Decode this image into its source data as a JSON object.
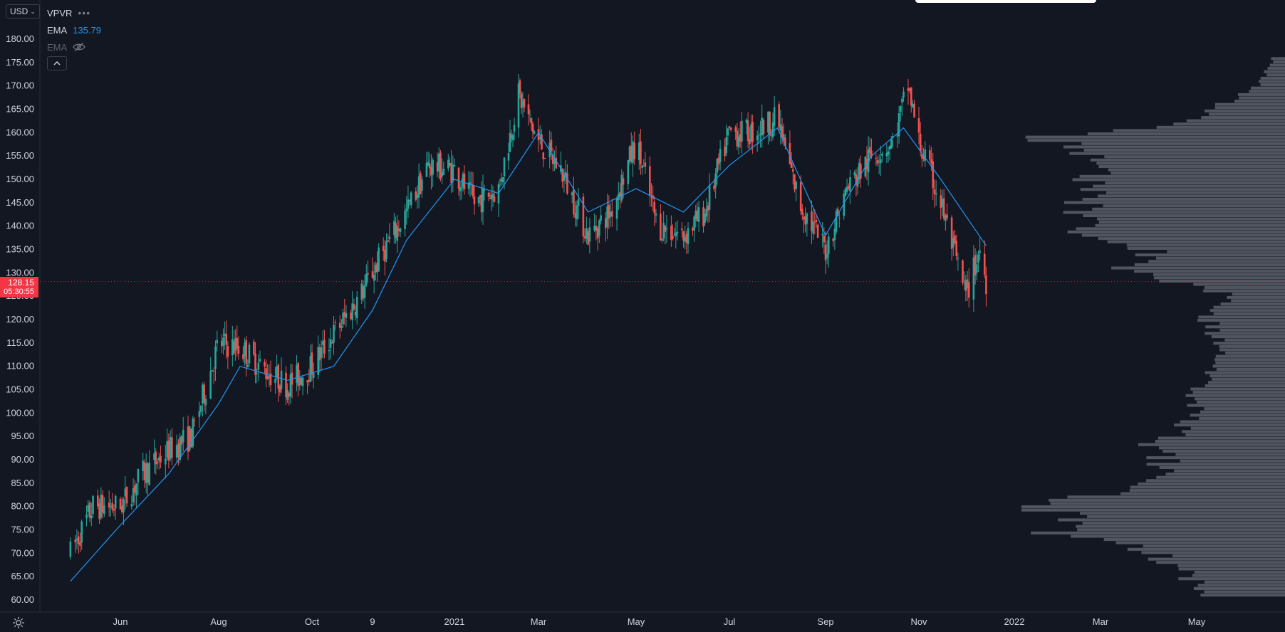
{
  "currency": "USD",
  "legend": {
    "indicator_name": "VPVR",
    "ema_label": "EMA",
    "ema_value": "135.79",
    "ema_hidden_label": "EMA"
  },
  "last_price": {
    "price": "128.15",
    "countdown": "05:30:55"
  },
  "icons": [
    "chevron-down-icon",
    "more-dots-icon",
    "eye-crossed-icon",
    "chevron-up-icon",
    "settings-icon"
  ],
  "colors": {
    "background": "#131722",
    "up_candle": "#26a69a",
    "down_candle": "#ef5350",
    "ema_line": "#2196f3",
    "volume_profile": "#787b86",
    "last_price_badge": "#f23645"
  },
  "chart_data": {
    "type": "candlestick",
    "y_axis": {
      "ticks": [
        60,
        65,
        70,
        75,
        80,
        85,
        90,
        95,
        100,
        105,
        110,
        115,
        120,
        125,
        130,
        135,
        140,
        145,
        150,
        155,
        160,
        165,
        170,
        175,
        180
      ],
      "tick_labels": [
        "60.00",
        "65.00",
        "70.00",
        "75.00",
        "80.00",
        "85.00",
        "90.00",
        "95.00",
        "100.00",
        "105.00",
        "110.00",
        "115.00",
        "120.00",
        "125.00",
        "130.00",
        "135.00",
        "140.00",
        "145.00",
        "150.00",
        "155.00",
        "160.00",
        "165.00",
        "170.00",
        "175.00",
        "180.00"
      ],
      "range": [
        58,
        185
      ]
    },
    "x_axis": {
      "tick_labels": [
        "Jun",
        "Aug",
        "Oct",
        "9",
        "2021",
        "Mar",
        "May",
        "Jul",
        "Sep",
        "Nov",
        "2022",
        "Mar",
        "May"
      ],
      "tick_dates": [
        "2020-06-01",
        "2020-08-01",
        "2020-10-01",
        "2020-11-09",
        "2021-01-01",
        "2021-03-01",
        "2021-05-01",
        "2021-07-01",
        "2021-09-01",
        "2021-11-01",
        "2022-01-01",
        "2022-03-01",
        "2022-05-01"
      ]
    },
    "series": [
      {
        "name": "Price",
        "kind": "candles",
        "start_date": "2020-05-01",
        "end_date": "2021-12-14",
        "anchor_closes": [
          [
            "2020-05-01",
            70
          ],
          [
            "2020-05-15",
            80
          ],
          [
            "2020-06-01",
            80
          ],
          [
            "2020-06-15",
            87
          ],
          [
            "2020-07-01",
            92
          ],
          [
            "2020-07-15",
            95
          ],
          [
            "2020-08-01",
            115
          ],
          [
            "2020-08-15",
            114
          ],
          [
            "2020-09-01",
            109
          ],
          [
            "2020-09-15",
            106
          ],
          [
            "2020-10-01",
            110
          ],
          [
            "2020-10-15",
            117
          ],
          [
            "2020-11-01",
            125
          ],
          [
            "2020-11-15",
            134
          ],
          [
            "2020-12-01",
            143
          ],
          [
            "2020-12-15",
            153
          ],
          [
            "2021-01-01",
            152
          ],
          [
            "2021-01-15",
            145
          ],
          [
            "2021-02-01",
            148
          ],
          [
            "2021-02-15",
            168
          ],
          [
            "2021-03-01",
            158
          ],
          [
            "2021-03-15",
            152
          ],
          [
            "2021-04-01",
            138
          ],
          [
            "2021-04-15",
            143
          ],
          [
            "2021-05-01",
            158
          ],
          [
            "2021-05-15",
            140
          ],
          [
            "2021-06-01",
            138
          ],
          [
            "2021-06-15",
            143
          ],
          [
            "2021-07-01",
            160
          ],
          [
            "2021-07-15",
            160
          ],
          [
            "2021-08-01",
            163
          ],
          [
            "2021-08-15",
            145
          ],
          [
            "2021-09-01",
            135
          ],
          [
            "2021-09-15",
            148
          ],
          [
            "2021-10-01",
            155
          ],
          [
            "2021-10-15",
            158
          ],
          [
            "2021-10-25",
            170
          ],
          [
            "2021-11-01",
            158
          ],
          [
            "2021-11-15",
            145
          ],
          [
            "2021-12-01",
            125
          ],
          [
            "2021-12-10",
            135
          ],
          [
            "2021-12-14",
            128
          ]
        ]
      },
      {
        "name": "EMA",
        "kind": "line",
        "points": [
          [
            "2020-05-01",
            64
          ],
          [
            "2020-06-01",
            76
          ],
          [
            "2020-07-01",
            87
          ],
          [
            "2020-08-01",
            102
          ],
          [
            "2020-08-15",
            110
          ],
          [
            "2020-09-15",
            107
          ],
          [
            "2020-10-15",
            110
          ],
          [
            "2020-11-09",
            122
          ],
          [
            "2020-12-01",
            137
          ],
          [
            "2021-01-01",
            150
          ],
          [
            "2021-02-01",
            147
          ],
          [
            "2021-03-01",
            160
          ],
          [
            "2021-04-01",
            143
          ],
          [
            "2021-05-01",
            148
          ],
          [
            "2021-06-01",
            143
          ],
          [
            "2021-07-01",
            153
          ],
          [
            "2021-08-01",
            161
          ],
          [
            "2021-09-01",
            138
          ],
          [
            "2021-10-01",
            155
          ],
          [
            "2021-10-22",
            161
          ],
          [
            "2021-11-15",
            150
          ],
          [
            "2021-12-14",
            135.79
          ]
        ]
      },
      {
        "name": "VPVR",
        "kind": "volume-profile",
        "price_levels": [
          [
            62,
            0.3
          ],
          [
            70,
            0.5
          ],
          [
            75,
            0.9
          ],
          [
            78,
            0.85
          ],
          [
            80,
            1.0
          ],
          [
            83,
            0.6
          ],
          [
            88,
            0.45
          ],
          [
            93,
            0.5
          ],
          [
            97,
            0.4
          ],
          [
            100,
            0.35
          ],
          [
            105,
            0.33
          ],
          [
            110,
            0.25
          ],
          [
            115,
            0.25
          ],
          [
            120,
            0.3
          ],
          [
            125,
            0.2
          ],
          [
            130,
            0.6
          ],
          [
            134,
            0.5
          ],
          [
            138,
            0.7
          ],
          [
            142,
            0.85
          ],
          [
            146,
            0.75
          ],
          [
            150,
            0.78
          ],
          [
            154,
            0.72
          ],
          [
            157,
            0.85
          ],
          [
            159,
            0.95
          ],
          [
            162,
            0.4
          ],
          [
            166,
            0.25
          ],
          [
            170,
            0.1
          ],
          [
            175,
            0.05
          ]
        ]
      }
    ]
  }
}
